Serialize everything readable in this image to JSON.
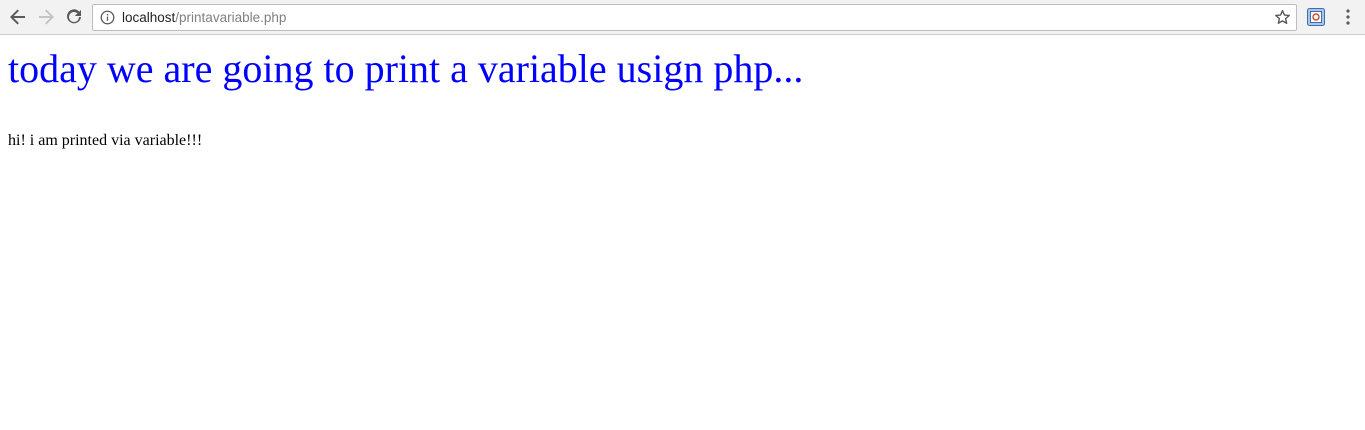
{
  "browser": {
    "url_host": "localhost",
    "url_path": "/printavariable.php"
  },
  "icons": {
    "back": "back-arrow-icon",
    "forward": "forward-arrow-icon",
    "reload": "reload-icon",
    "info": "info-icon",
    "bookmark": "star-icon",
    "extension": "extension-icon",
    "menu": "kebab-menu-icon"
  },
  "page": {
    "heading": "today we are going to print a variable usign php...",
    "text": "hi! i am printed via variable!!!"
  },
  "colors": {
    "heading": "#0000ff",
    "text": "#000000",
    "toolbar": "#f2f2f2"
  }
}
